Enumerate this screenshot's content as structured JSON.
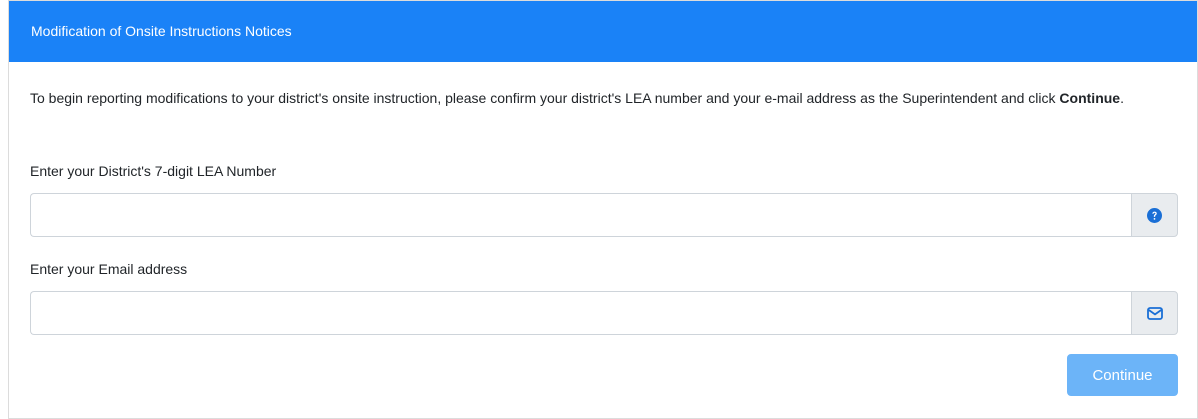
{
  "header": {
    "title": "Modification of Onsite Instructions Notices"
  },
  "intro": {
    "text_before": "To begin reporting modifications to your district's onsite instruction, please confirm your district's LEA number and your e-mail address as the Superintendent and click ",
    "emphasis": "Continue",
    "text_after": "."
  },
  "lea_field": {
    "label": "Enter your District's 7-digit LEA Number",
    "value": "",
    "placeholder": "",
    "icon": "question-circle-icon"
  },
  "email_field": {
    "label": "Enter your Email address",
    "value": "",
    "placeholder": "",
    "icon": "envelope-icon"
  },
  "continue_button": {
    "label": "Continue"
  },
  "colors": {
    "header_bg": "#1a82f7",
    "button_bg": "#6cb4f8",
    "icon_color": "#1a6fd6"
  }
}
